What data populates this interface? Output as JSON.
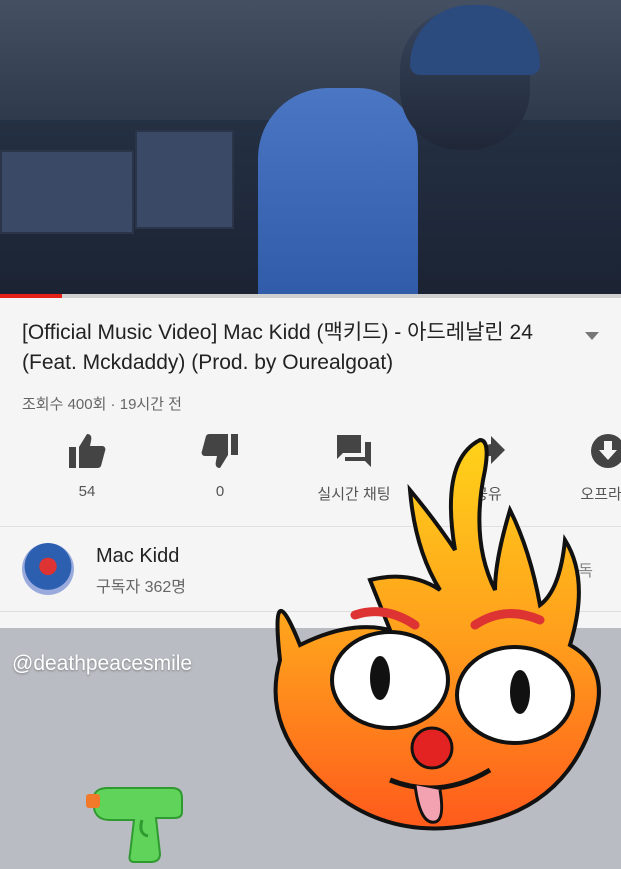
{
  "video": {
    "progress_percent": 10
  },
  "title": "[Official Music Video] Mac Kidd (맥키드) - 아드레날린 24 (Feat. Mckdaddy) (Prod. by Ourealgoat)",
  "meta": "조회수 400회 · 19시간 전",
  "actions": [
    {
      "icon": "thumbs-up-icon",
      "label": "54"
    },
    {
      "icon": "thumbs-down-icon",
      "label": "0"
    },
    {
      "icon": "chat-icon",
      "label": "실시간 채팅"
    },
    {
      "icon": "share-icon",
      "label": "공유"
    },
    {
      "icon": "download-icon",
      "label": "오프라인"
    }
  ],
  "channel": {
    "name": "Mac Kidd",
    "subscribers": "구독자 362명",
    "subscribe_label": "구독"
  },
  "sticker": {
    "handle": "@deathpeacesmile"
  },
  "colors": {
    "accent": "#e62117",
    "panel": "#f5f5f5",
    "bg": "#b9bcc2"
  }
}
